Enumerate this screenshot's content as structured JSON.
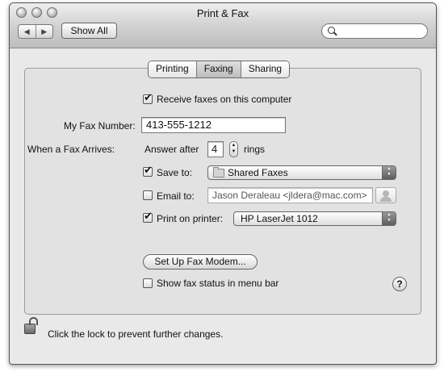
{
  "window": {
    "title": "Print & Fax"
  },
  "toolbar": {
    "back_icon": "◀",
    "forward_icon": "▶",
    "show_all_label": "Show All",
    "search_placeholder": ""
  },
  "tabs": [
    {
      "label": "Printing",
      "selected": false
    },
    {
      "label": "Faxing",
      "selected": true
    },
    {
      "label": "Sharing",
      "selected": false
    }
  ],
  "faxing": {
    "receive_faxes": {
      "label": "Receive faxes on this computer",
      "checked": true
    },
    "fax_number": {
      "label": "My Fax Number:",
      "value": "413-555-1212"
    },
    "when_arrives": {
      "label": "When a Fax Arrives:",
      "answer_after_label": "Answer after",
      "rings_value": "4",
      "rings_label": "rings"
    },
    "save_to": {
      "label": "Save to:",
      "checked": true,
      "value": "Shared Faxes"
    },
    "email_to": {
      "label": "Email to:",
      "checked": false,
      "value": "Jason Deraleau <jldera@mac.com>"
    },
    "print_on_printer": {
      "label": "Print on printer:",
      "checked": true,
      "value": "HP LaserJet 1012"
    },
    "setup_modem_label": "Set Up Fax Modem...",
    "show_status": {
      "label": "Show fax status in menu bar",
      "checked": false
    },
    "help_label": "?"
  },
  "lock": {
    "text": "Click the lock to prevent further changes."
  }
}
